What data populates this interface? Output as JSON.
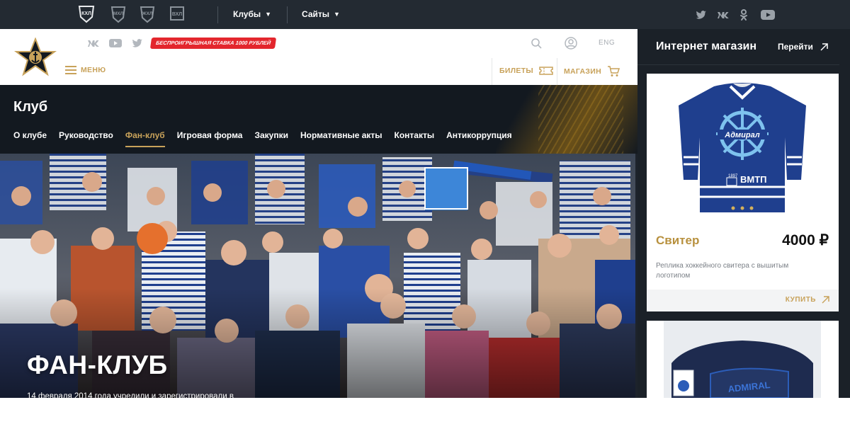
{
  "league_bar": {
    "logos": [
      {
        "name": "КХЛ",
        "icon": "khl-logo-icon"
      },
      {
        "name": "МХЛ",
        "icon": "mhl-logo-icon"
      },
      {
        "name": "ВХЛ",
        "icon": "vhl-logo-icon"
      },
      {
        "name": "ЖХЛ",
        "icon": "whl-logo-icon"
      }
    ],
    "clubs_label": "Клубы",
    "sites_label": "Сайты",
    "social": [
      "twitter-icon",
      "vk-icon",
      "odnoklassniki-icon",
      "youtube-icon"
    ]
  },
  "header": {
    "club_logo": "admiral-logo-icon",
    "social": [
      "vk-icon",
      "youtube-icon",
      "twitter-icon"
    ],
    "promo": "БЕСПРОИГРЫШНАЯ СТАВКА 1000 РУБЛЕЙ",
    "menu_label": "МЕНЮ",
    "lang": "ENG",
    "tickets_label": "БИЛЕТЫ",
    "shop_label": "МАГАЗИН"
  },
  "club_menu": {
    "title": "Клуб",
    "items": [
      {
        "label": "О клубе",
        "active": false
      },
      {
        "label": "Руководство",
        "active": false
      },
      {
        "label": "Фан-клуб",
        "active": true
      },
      {
        "label": "Игровая форма",
        "active": false
      },
      {
        "label": "Закупки",
        "active": false
      },
      {
        "label": "Нормативные акты",
        "active": false
      },
      {
        "label": "Контакты",
        "active": false
      },
      {
        "label": "Антикоррупция",
        "active": false
      }
    ]
  },
  "hero": {
    "title": "ФАН-КЛУБ",
    "text": "14 февраля 2014 года учредили и зарегистрировали в"
  },
  "shop": {
    "title": "Интернет магазин",
    "go_label": "Перейти",
    "product": {
      "name": "Свитер",
      "price": "4000 ₽",
      "description": "Реплика хоккейного свитера с вышитым логотипом",
      "buy_label": "КУПИТЬ",
      "jersey_text": "ВМТП",
      "jersey_year": "1897",
      "jersey_logo": "Адмирал"
    },
    "product2": {
      "cap_text": "ADMIRAL"
    }
  },
  "colors": {
    "gold": "#c8a25a",
    "dark": "#131920",
    "promo_red": "#e3262d",
    "jersey_blue": "#1f3f8e"
  }
}
